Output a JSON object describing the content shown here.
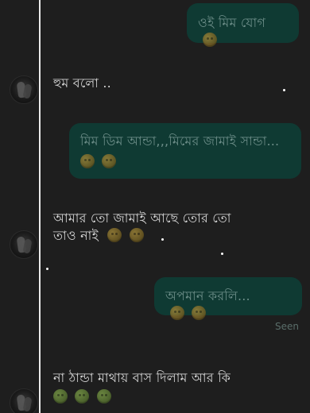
{
  "conversation": {
    "messages": [
      {
        "id": "m1",
        "direction": "outgoing",
        "text": "ওই মিম যোগ",
        "emojis": [
          "sweat-smile-emoji"
        ]
      },
      {
        "id": "m2",
        "direction": "incoming",
        "text": "হুম বলো ..",
        "emojis": []
      },
      {
        "id": "m3",
        "direction": "outgoing",
        "text": "মিম ডিম আন্ডা,,,মিমের জামাই সান্ডা...",
        "emojis": [
          "grimace-emoji",
          "blush-emoji"
        ]
      },
      {
        "id": "m4",
        "direction": "incoming",
        "text_line1": "আমার তো জামাই আছে তোর তো",
        "text_line2": "তাও নাই",
        "emojis": [
          "neutral-face-emoji",
          "slight-smile-emoji"
        ]
      },
      {
        "id": "m5",
        "direction": "outgoing",
        "text": "অপমান করলি...",
        "emojis": [
          "disappointed-emoji",
          "disappointed-emoji"
        ]
      },
      {
        "id": "m6",
        "direction": "incoming",
        "text": "না ঠান্ডা মাথায় বাস দিলাম আর কি",
        "emojis": [
          "frog-emoji",
          "frog-emoji",
          "frog-emoji"
        ]
      }
    ],
    "seen_label": "Seen"
  },
  "colors": {
    "background": "#1e1e1e",
    "outgoing_bubble": "#0f3a33",
    "outgoing_text": "#6c8d88",
    "incoming_text": "#d6d6d6",
    "guide_line": "#e9e9e9"
  }
}
